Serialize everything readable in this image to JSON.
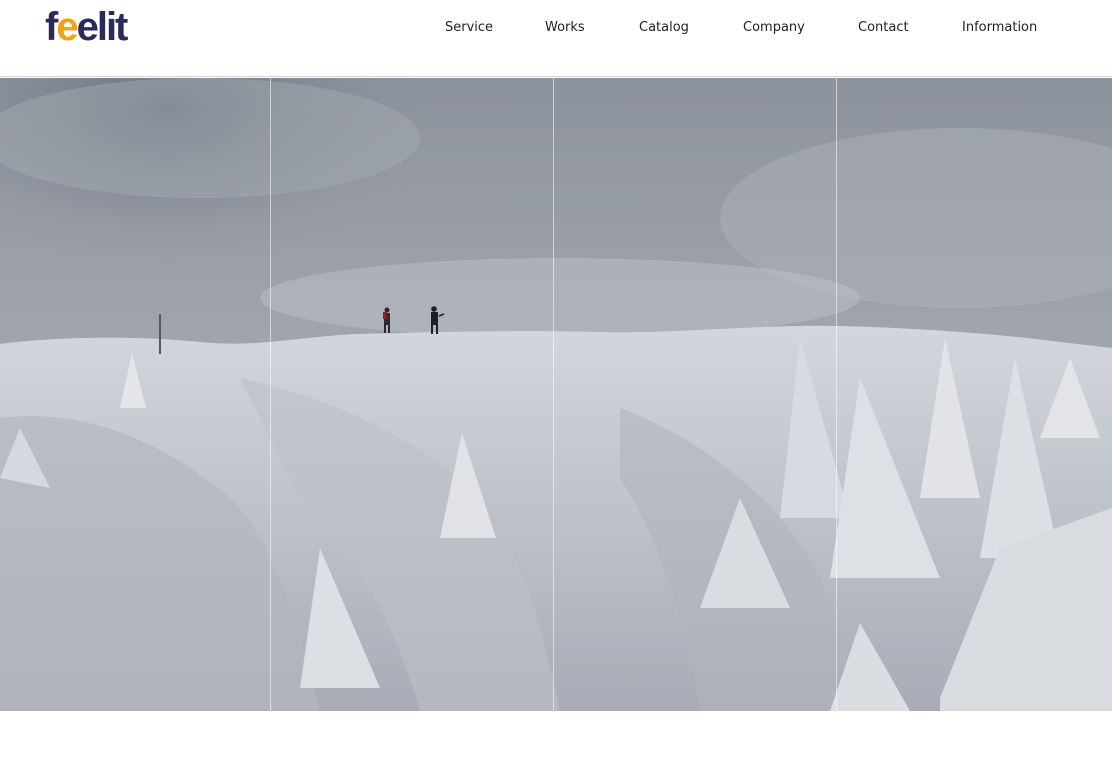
{
  "logo": {
    "prefix": "f",
    "accent": "e",
    "rest": "elit"
  },
  "nav": {
    "items": [
      {
        "label": "Service"
      },
      {
        "label": "Works"
      },
      {
        "label": "Catalog"
      },
      {
        "label": "Company"
      },
      {
        "label": "Contact"
      },
      {
        "label": "Information"
      }
    ]
  },
  "colors": {
    "logo_text": "#2b2a5a",
    "logo_accent": "#f0a21b",
    "sky": "#8e939b",
    "snow": "#c9ccd3"
  },
  "hero": {
    "image": "snowy-mountain-ridge-with-hikers"
  }
}
